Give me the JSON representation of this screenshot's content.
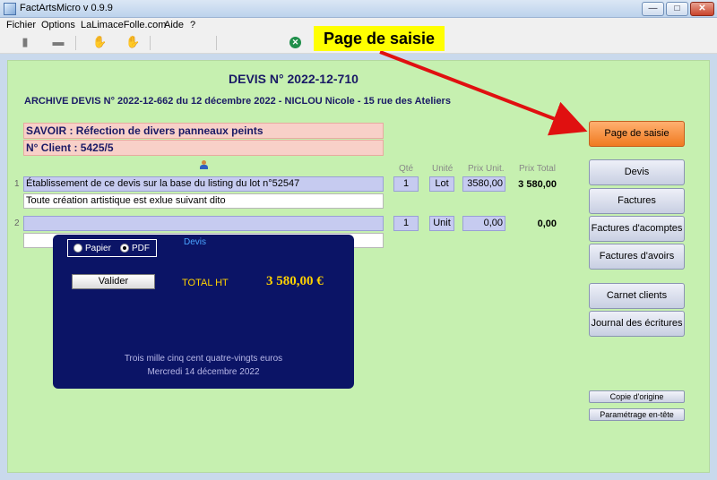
{
  "window": {
    "title": "FactArtsMicro v 0.9.9",
    "minimize": "—",
    "maximize": "□",
    "close": "✕"
  },
  "menu": [
    "Fichier",
    "Options",
    "LaLimaceFolle.com",
    "Aide",
    "?"
  ],
  "callout": "Page de saisie",
  "doc": {
    "title": "DEVIS N° 2022-12-710",
    "archive": "ARCHIVE DEVIS N° 2022-12-662 du 12 décembre 2022  -  NICLOU Nicole  -  15 rue des Ateliers",
    "subject": "SAVOIR : Réfection de divers panneaux peints",
    "client": "N° Client : 5425/5"
  },
  "columns": {
    "qty": "Qté",
    "unit": "Unité",
    "unit_price": "Prix Unit.",
    "total": "Prix Total"
  },
  "lines": [
    {
      "num": "1",
      "designation": "Établissement de ce devis sur la base du listing du lot n°52547",
      "detail": "Toute création artistique est exlue suivant dito",
      "qty": "1",
      "unit": "Lot",
      "price": "3580,00",
      "total": "3 580,00"
    },
    {
      "num": "2",
      "designation": "",
      "detail": "",
      "qty": "1",
      "unit": "Unit",
      "price": "0,00",
      "total": "0,00"
    }
  ],
  "popup": {
    "paper": "Papier",
    "pdf": "PDF",
    "selected": "PDF",
    "label": "Devis",
    "validate": "Valider",
    "total_label": "TOTAL HT",
    "total_value": "3 580,00 €",
    "amount_words": "Trois mille cinq cent quatre-vingts euros",
    "date": "Mercredi 14 décembre 2022"
  },
  "buttons": {
    "page_saisie": "Page de saisie",
    "devis": "Devis",
    "factures": "Factures",
    "factures_acomptes": "Factures d'acomptes",
    "factures_avoirs": "Factures d'avoirs",
    "carnet_clients": "Carnet clients",
    "journal": "Journal des écritures",
    "copie_origine": "Copie d'origine",
    "parametrage": "Paramétrage en-tête"
  },
  "colors": {
    "background_green": "#c6f0b0",
    "popup_navy": "#0b1466",
    "accent_orange": "#f07a20",
    "callout_yellow": "#ffff00",
    "arrow_red": "#e01010"
  }
}
